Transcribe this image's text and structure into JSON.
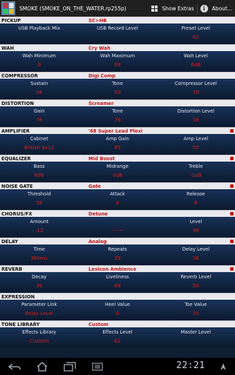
{
  "app": {
    "title": "SMOKE (SMOKE_ON_THE_WATER.rp255p)"
  },
  "actionbar": {
    "show_extras": "Show Extras",
    "about": "About..."
  },
  "sections": [
    {
      "name": "PICKUP",
      "value": "SC>HB",
      "marker": false,
      "params": [
        {
          "label": "USB Playback Mix",
          "value": ""
        },
        {
          "label": "USB Record Level",
          "value": ""
        },
        {
          "label": "Preset Level",
          "value": "62"
        }
      ]
    },
    {
      "name": "WAH",
      "value": "Cry Wah",
      "marker": false,
      "params": [
        {
          "label": "Wah Minimum",
          "value": "0"
        },
        {
          "label": "Wah Maximum",
          "value": "99"
        },
        {
          "label": "Wah Level",
          "value": "6dB"
        }
      ]
    },
    {
      "name": "COMPRESSOR",
      "value": "Digi Comp",
      "marker": false,
      "params": [
        {
          "label": "Sustain",
          "value": "58"
        },
        {
          "label": "Tone",
          "value": "50"
        },
        {
          "label": "Compressor Level",
          "value": "70"
        }
      ]
    },
    {
      "name": "DISTORTION",
      "value": "Screamer",
      "marker": false,
      "params": [
        {
          "label": "Gain",
          "value": "76"
        },
        {
          "label": "Tone",
          "value": "76"
        },
        {
          "label": "Distortion Level",
          "value": "38"
        }
      ]
    },
    {
      "name": "AMPLIFIER",
      "value": "'68 Super Lead Plexi",
      "marker": true,
      "params": [
        {
          "label": "Cabinet",
          "value": "British 4x12"
        },
        {
          "label": "Amp Gain",
          "value": "85"
        },
        {
          "label": "Amp Level",
          "value": "55"
        }
      ]
    },
    {
      "name": "EQUALIZER",
      "value": "Mid Boost",
      "marker": true,
      "params": [
        {
          "label": "Bass",
          "value": "6dB"
        },
        {
          "label": "Midrange",
          "value": "0dB"
        },
        {
          "label": "Treble",
          "value": "-1dB"
        }
      ]
    },
    {
      "name": "NOISE GATE",
      "value": "Gate",
      "marker": true,
      "params": [
        {
          "label": "Threshold",
          "value": "58"
        },
        {
          "label": "Attack",
          "value": "0"
        },
        {
          "label": "Release",
          "value": "8"
        }
      ]
    },
    {
      "name": "CHORUS/FX",
      "value": "Detune",
      "marker": true,
      "params": [
        {
          "label": "Amount",
          "value": "-12"
        },
        {
          "label": "",
          "value": "------"
        },
        {
          "label": "Level",
          "value": "99"
        }
      ]
    },
    {
      "name": "DELAY",
      "value": "Analog",
      "marker": true,
      "params": [
        {
          "label": "Time",
          "value": "360ms"
        },
        {
          "label": "Repeats",
          "value": "25"
        },
        {
          "label": "Delay Level",
          "value": "36"
        }
      ]
    },
    {
      "name": "REVERB",
      "value": "Lexicon Ambience",
      "marker": true,
      "params": [
        {
          "label": "Decay",
          "value": "39"
        },
        {
          "label": "Liveliness",
          "value": "88"
        },
        {
          "label": "Reverb Level",
          "value": "50"
        }
      ]
    },
    {
      "name": "EXPRESSION",
      "value": "",
      "marker": false,
      "params": [
        {
          "label": "Parameter Link",
          "value": "Relay Level"
        },
        {
          "label": "Heel Value",
          "value": "0"
        },
        {
          "label": "Toe Value",
          "value": "35"
        }
      ]
    },
    {
      "name": "TONE LIBRARY",
      "value": "Custom",
      "marker": false,
      "params": [
        {
          "label": "Effects Library",
          "value": "Custom"
        },
        {
          "label": "Effects Level",
          "value": "62"
        },
        {
          "label": "Master Level",
          "value": ""
        }
      ]
    }
  ],
  "statusbar": {
    "clock": "22:21"
  },
  "icons": [
    "app-icon",
    "grid-icon",
    "info-icon",
    "back-icon",
    "home-icon",
    "recent-apps-icon",
    "menu-icon",
    "notification-icon"
  ]
}
